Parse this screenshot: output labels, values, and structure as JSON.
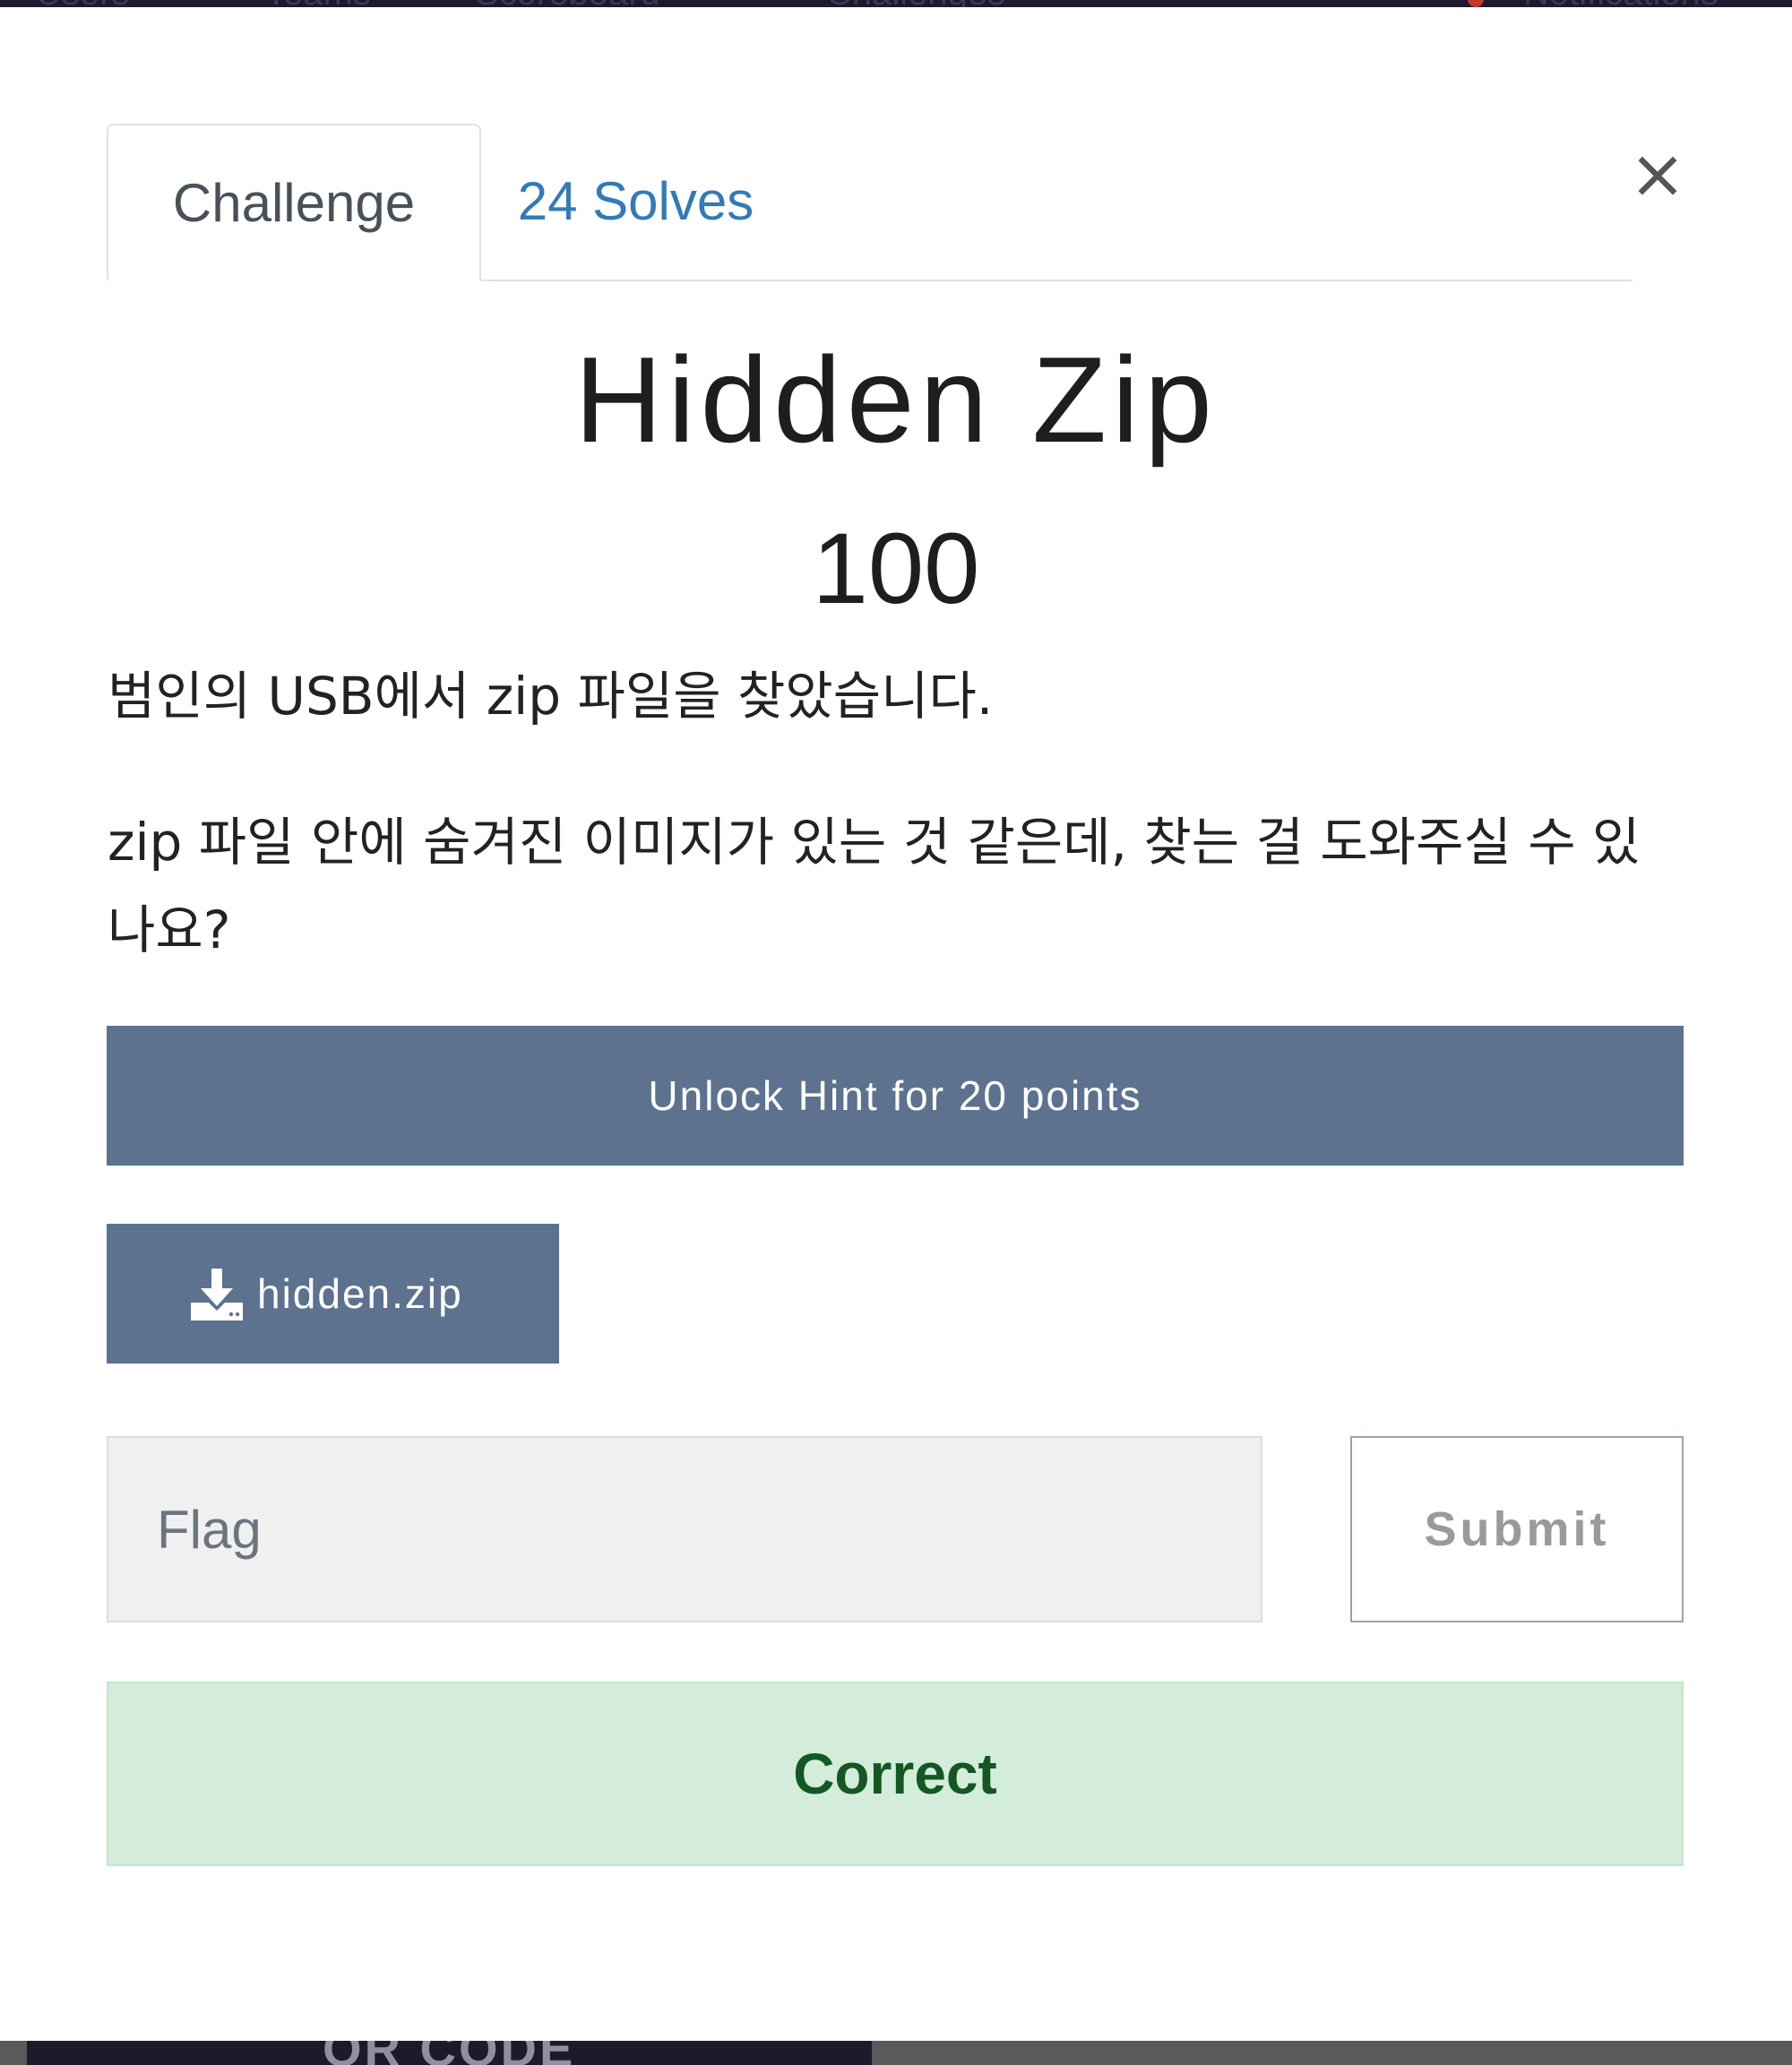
{
  "background_nav": {
    "items": [
      "Users",
      "Teams",
      "Scoreboard",
      "Challenges",
      "Notifications"
    ]
  },
  "tabs": {
    "challenge": "Challenge",
    "solves": "24 Solves"
  },
  "close_symbol": "×",
  "challenge": {
    "name": "Hidden Zip",
    "value": "100",
    "description": [
      "범인의 USB에서 zip 파일을 찾았습니다.",
      "zip 파일 안에 숨겨진 이미지가 있는 것 같은데, 찾는 걸 도와주실 수 있나요?"
    ]
  },
  "hint_button": "Unlock Hint for 20 points",
  "file": {
    "name": "hidden.zip",
    "icon": "download-icon"
  },
  "flag_form": {
    "placeholder": "Flag",
    "value": "",
    "submit_label": "Submit"
  },
  "result": {
    "message": "Correct",
    "status": "success"
  },
  "background_footer": {
    "text": "QR CODE"
  },
  "colors": {
    "primary_button": "#5c728f",
    "link": "#337ab7",
    "success_bg": "#d4edda",
    "success_text": "#155724",
    "navbar": "#1c1b2e"
  }
}
